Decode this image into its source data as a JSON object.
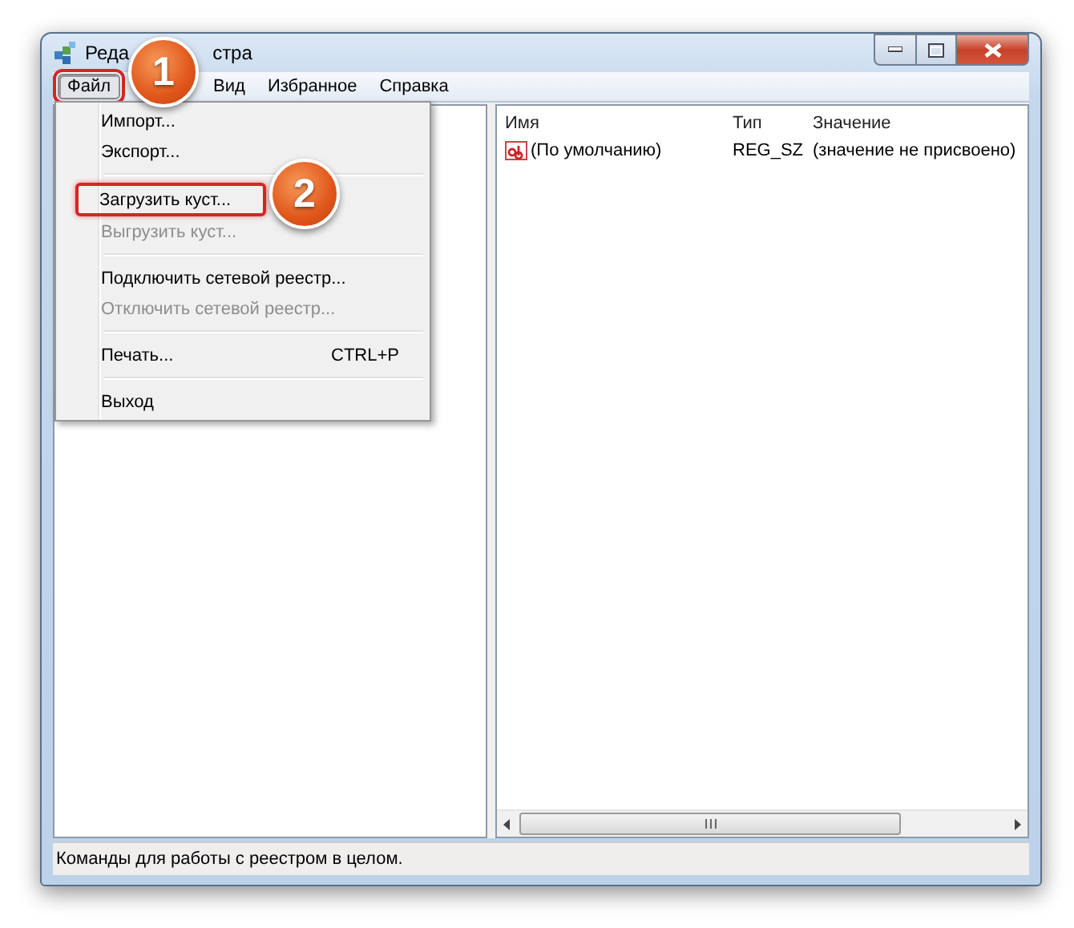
{
  "window": {
    "title_parts": [
      "Реда",
      "стра"
    ]
  },
  "menu_bar": [
    {
      "label": "Файл",
      "selected": true,
      "highlighted": true
    },
    {
      "label": "Вид",
      "selected": false,
      "highlighted": false
    },
    {
      "label": "Избранное",
      "selected": false,
      "highlighted": false
    },
    {
      "label": "Справка",
      "selected": false,
      "highlighted": false
    }
  ],
  "file_menu": {
    "groups": [
      [
        {
          "label": "Импорт...",
          "disabled": false,
          "highlighted": false
        },
        {
          "label": "Экспорт...",
          "disabled": false,
          "highlighted": false
        }
      ],
      [
        {
          "label": "Загрузить куст...",
          "disabled": false,
          "highlighted": true
        },
        {
          "label": "Выгрузить куст...",
          "disabled": true,
          "highlighted": false
        }
      ],
      [
        {
          "label": "Подключить сетевой реестр...",
          "disabled": false,
          "highlighted": false
        },
        {
          "label": "Отключить сетевой реестр...",
          "disabled": true,
          "highlighted": false
        }
      ],
      [
        {
          "label": "Печать...",
          "shortcut": "CTRL+P",
          "disabled": false,
          "highlighted": false
        }
      ],
      [
        {
          "label": "Выход",
          "disabled": false,
          "highlighted": false
        }
      ]
    ]
  },
  "values_list": {
    "columns": [
      "Имя",
      "Тип",
      "Значение"
    ],
    "rows": [
      {
        "name": "(По умолчанию)",
        "type": "REG_SZ",
        "value": "(значение не присвоено)"
      }
    ]
  },
  "status_bar": "Команды для работы с реестром в целом.",
  "annotations": [
    {
      "text": "1"
    },
    {
      "text": "2"
    }
  ]
}
